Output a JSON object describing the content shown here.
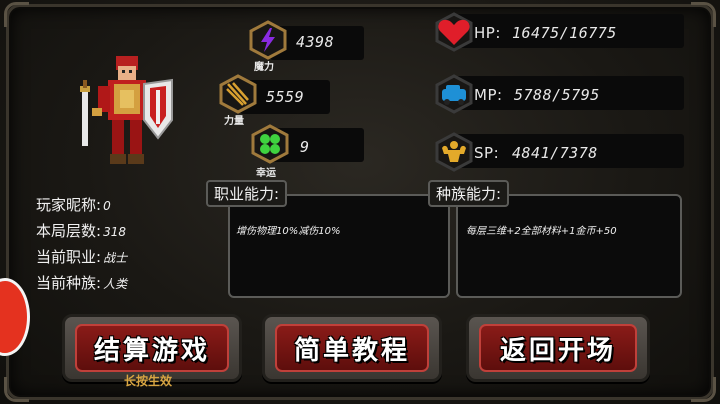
{
  "stats": {
    "magic": {
      "icon": "lightning-icon",
      "label": "魔力",
      "value": "4398"
    },
    "strength": {
      "icon": "arrows-icon",
      "label": "力量",
      "value": "5559"
    },
    "luck": {
      "icon": "clover-icon",
      "label": "幸运",
      "value": "9"
    }
  },
  "vitals": {
    "hp": {
      "icon": "heart-icon",
      "label": "HP:",
      "value": "16475/16775"
    },
    "mp": {
      "icon": "car-icon",
      "label": "MP:",
      "value": "5788/5795"
    },
    "sp": {
      "icon": "muscle-icon",
      "label": "SP:",
      "value": "4841/7378"
    }
  },
  "player": {
    "nickname_label": "玩家昵称:",
    "nickname": "0",
    "floors_label": "本局层数:",
    "floors": "318",
    "class_label": "当前职业:",
    "class": "战士",
    "race_label": "当前种族:",
    "race": "人类"
  },
  "panels": {
    "class_ability": {
      "title": "职业能力:",
      "text": "增伤物理10%减伤10%"
    },
    "race_ability": {
      "title": "种族能力:",
      "text": "每层三维+2全部材料+1金币+50"
    }
  },
  "buttons": {
    "settle": {
      "label": "结算游戏",
      "note": "长按生效"
    },
    "tutorial": {
      "label": "简单教程"
    },
    "return": {
      "label": "返回开场"
    }
  },
  "colors": {
    "accent_red": "#8a1b18",
    "gold_text": "#d8a542",
    "hex_gold": "#a07a3c"
  }
}
